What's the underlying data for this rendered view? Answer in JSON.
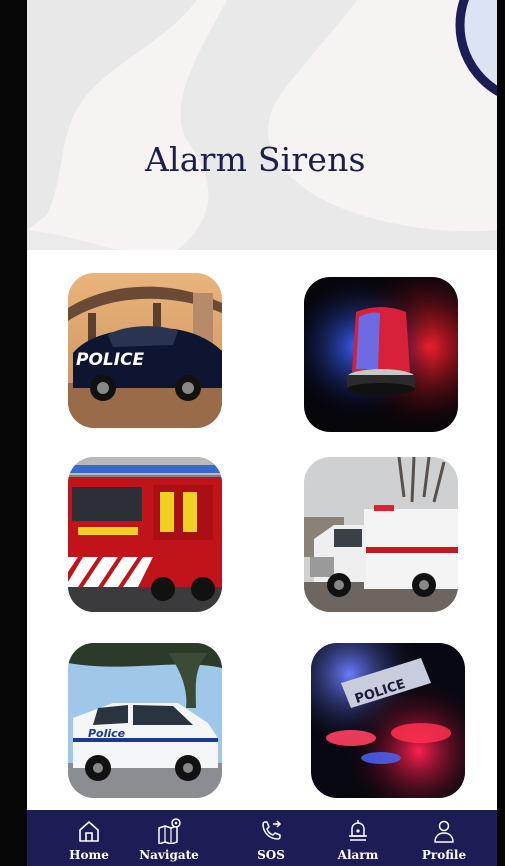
{
  "header": {
    "title": "Alarm Sirens"
  },
  "sirens": [
    {
      "id": "police-car",
      "icon": "police-car-photo"
    },
    {
      "id": "siren-light",
      "icon": "siren-light-photo"
    },
    {
      "id": "fire-truck",
      "icon": "fire-truck-photo"
    },
    {
      "id": "ambulance",
      "icon": "ambulance-photo"
    },
    {
      "id": "police-ute",
      "icon": "police-ute-photo"
    },
    {
      "id": "police-lights",
      "icon": "police-lights-photo"
    }
  ],
  "nav": {
    "items": [
      {
        "label": "Home",
        "icon": "home-icon"
      },
      {
        "label": "Navigate",
        "icon": "map-icon"
      },
      {
        "label": "SOS",
        "icon": "phone-call-icon"
      },
      {
        "label": "Alarm",
        "icon": "bell-icon"
      },
      {
        "label": "Profile",
        "icon": "user-icon"
      }
    ]
  },
  "colors": {
    "navbar": "#1c1d55",
    "title": "#1b1f4a",
    "header_bg": "#f7f3f3"
  }
}
